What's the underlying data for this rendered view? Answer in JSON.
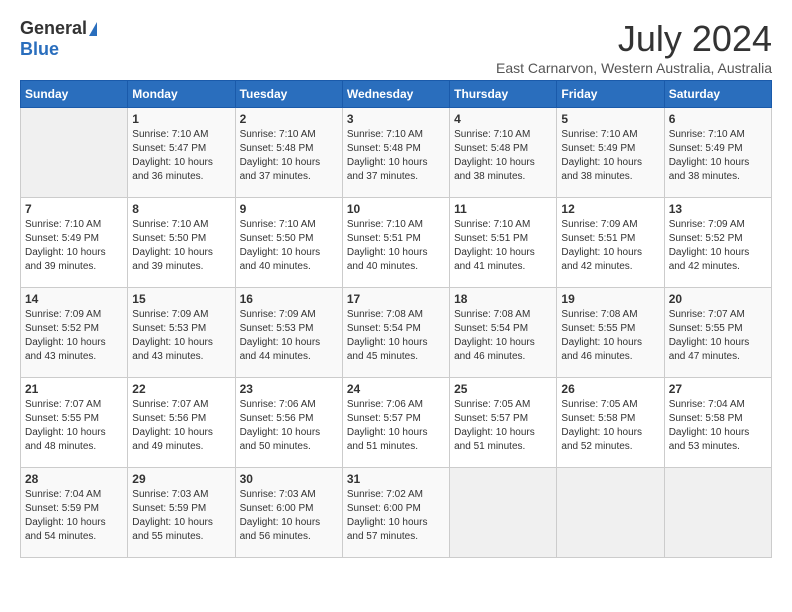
{
  "header": {
    "logo_general": "General",
    "logo_blue": "Blue",
    "month": "July 2024",
    "location": "East Carnarvon, Western Australia, Australia"
  },
  "days_of_week": [
    "Sunday",
    "Monday",
    "Tuesday",
    "Wednesday",
    "Thursday",
    "Friday",
    "Saturday"
  ],
  "weeks": [
    [
      {
        "day": "",
        "info": ""
      },
      {
        "day": "1",
        "info": "Sunrise: 7:10 AM\nSunset: 5:47 PM\nDaylight: 10 hours\nand 36 minutes."
      },
      {
        "day": "2",
        "info": "Sunrise: 7:10 AM\nSunset: 5:48 PM\nDaylight: 10 hours\nand 37 minutes."
      },
      {
        "day": "3",
        "info": "Sunrise: 7:10 AM\nSunset: 5:48 PM\nDaylight: 10 hours\nand 37 minutes."
      },
      {
        "day": "4",
        "info": "Sunrise: 7:10 AM\nSunset: 5:48 PM\nDaylight: 10 hours\nand 38 minutes."
      },
      {
        "day": "5",
        "info": "Sunrise: 7:10 AM\nSunset: 5:49 PM\nDaylight: 10 hours\nand 38 minutes."
      },
      {
        "day": "6",
        "info": "Sunrise: 7:10 AM\nSunset: 5:49 PM\nDaylight: 10 hours\nand 38 minutes."
      }
    ],
    [
      {
        "day": "7",
        "info": "Sunrise: 7:10 AM\nSunset: 5:49 PM\nDaylight: 10 hours\nand 39 minutes."
      },
      {
        "day": "8",
        "info": "Sunrise: 7:10 AM\nSunset: 5:50 PM\nDaylight: 10 hours\nand 39 minutes."
      },
      {
        "day": "9",
        "info": "Sunrise: 7:10 AM\nSunset: 5:50 PM\nDaylight: 10 hours\nand 40 minutes."
      },
      {
        "day": "10",
        "info": "Sunrise: 7:10 AM\nSunset: 5:51 PM\nDaylight: 10 hours\nand 40 minutes."
      },
      {
        "day": "11",
        "info": "Sunrise: 7:10 AM\nSunset: 5:51 PM\nDaylight: 10 hours\nand 41 minutes."
      },
      {
        "day": "12",
        "info": "Sunrise: 7:09 AM\nSunset: 5:51 PM\nDaylight: 10 hours\nand 42 minutes."
      },
      {
        "day": "13",
        "info": "Sunrise: 7:09 AM\nSunset: 5:52 PM\nDaylight: 10 hours\nand 42 minutes."
      }
    ],
    [
      {
        "day": "14",
        "info": "Sunrise: 7:09 AM\nSunset: 5:52 PM\nDaylight: 10 hours\nand 43 minutes."
      },
      {
        "day": "15",
        "info": "Sunrise: 7:09 AM\nSunset: 5:53 PM\nDaylight: 10 hours\nand 43 minutes."
      },
      {
        "day": "16",
        "info": "Sunrise: 7:09 AM\nSunset: 5:53 PM\nDaylight: 10 hours\nand 44 minutes."
      },
      {
        "day": "17",
        "info": "Sunrise: 7:08 AM\nSunset: 5:54 PM\nDaylight: 10 hours\nand 45 minutes."
      },
      {
        "day": "18",
        "info": "Sunrise: 7:08 AM\nSunset: 5:54 PM\nDaylight: 10 hours\nand 46 minutes."
      },
      {
        "day": "19",
        "info": "Sunrise: 7:08 AM\nSunset: 5:55 PM\nDaylight: 10 hours\nand 46 minutes."
      },
      {
        "day": "20",
        "info": "Sunrise: 7:07 AM\nSunset: 5:55 PM\nDaylight: 10 hours\nand 47 minutes."
      }
    ],
    [
      {
        "day": "21",
        "info": "Sunrise: 7:07 AM\nSunset: 5:55 PM\nDaylight: 10 hours\nand 48 minutes."
      },
      {
        "day": "22",
        "info": "Sunrise: 7:07 AM\nSunset: 5:56 PM\nDaylight: 10 hours\nand 49 minutes."
      },
      {
        "day": "23",
        "info": "Sunrise: 7:06 AM\nSunset: 5:56 PM\nDaylight: 10 hours\nand 50 minutes."
      },
      {
        "day": "24",
        "info": "Sunrise: 7:06 AM\nSunset: 5:57 PM\nDaylight: 10 hours\nand 51 minutes."
      },
      {
        "day": "25",
        "info": "Sunrise: 7:05 AM\nSunset: 5:57 PM\nDaylight: 10 hours\nand 51 minutes."
      },
      {
        "day": "26",
        "info": "Sunrise: 7:05 AM\nSunset: 5:58 PM\nDaylight: 10 hours\nand 52 minutes."
      },
      {
        "day": "27",
        "info": "Sunrise: 7:04 AM\nSunset: 5:58 PM\nDaylight: 10 hours\nand 53 minutes."
      }
    ],
    [
      {
        "day": "28",
        "info": "Sunrise: 7:04 AM\nSunset: 5:59 PM\nDaylight: 10 hours\nand 54 minutes."
      },
      {
        "day": "29",
        "info": "Sunrise: 7:03 AM\nSunset: 5:59 PM\nDaylight: 10 hours\nand 55 minutes."
      },
      {
        "day": "30",
        "info": "Sunrise: 7:03 AM\nSunset: 6:00 PM\nDaylight: 10 hours\nand 56 minutes."
      },
      {
        "day": "31",
        "info": "Sunrise: 7:02 AM\nSunset: 6:00 PM\nDaylight: 10 hours\nand 57 minutes."
      },
      {
        "day": "",
        "info": ""
      },
      {
        "day": "",
        "info": ""
      },
      {
        "day": "",
        "info": ""
      }
    ]
  ]
}
